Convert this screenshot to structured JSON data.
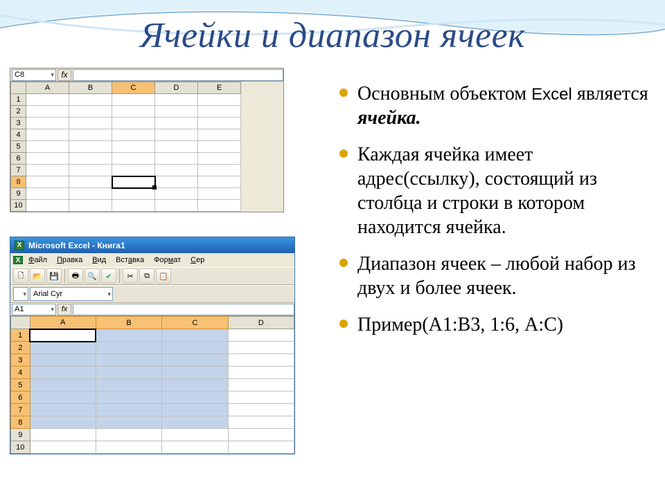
{
  "slide": {
    "title": "Ячейки и диапазон ячеек"
  },
  "bullets": {
    "b1a": "Основным объектом ",
    "b1b": "Excel",
    "b1c": " является ",
    "b1d": "ячейка.",
    "b2": "Каждая ячейка имеет адрес(ссылку), состоящий из столбца и строки в котором находится ячейка.",
    "b3": "Диапазон ячеек – любой набор из двух и более ячеек.",
    "b4": "Пример(А1:В3, 1:6, А:С)"
  },
  "excel_a": {
    "name_box": "C8",
    "fx_label": "fx",
    "columns": [
      "A",
      "B",
      "C",
      "D",
      "E"
    ],
    "rows": [
      "1",
      "2",
      "3",
      "4",
      "5",
      "6",
      "7",
      "8",
      "9",
      "10"
    ],
    "selected_col": "C",
    "selected_row": "8"
  },
  "excel_b": {
    "window_title": "Microsoft Excel - Книга1",
    "menu": {
      "file": "Файл",
      "edit": "Правка",
      "view": "Вид",
      "insert": "Вставка",
      "format": "Формат",
      "service": "Сер"
    },
    "toolbar_icons": [
      "new",
      "open",
      "save",
      "print",
      "preview",
      "spell",
      "cut",
      "copy",
      "paste"
    ],
    "font_name": "Arial Cyr",
    "name_box": "A1",
    "fx_label": "fx",
    "columns": [
      "A",
      "B",
      "C",
      "D"
    ],
    "rows": [
      "1",
      "2",
      "3",
      "4",
      "5",
      "6",
      "7",
      "8",
      "9",
      "10"
    ],
    "selection": "A1:C8"
  }
}
